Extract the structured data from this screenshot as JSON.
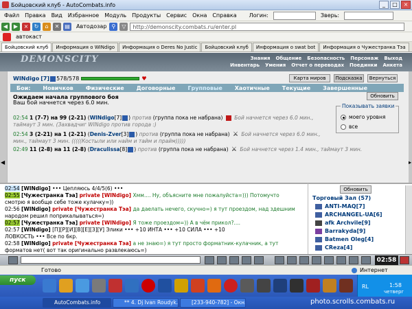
{
  "window": {
    "title": "Бойцовский клуб - AutoCombats.info"
  },
  "menu": {
    "items": [
      "Файл",
      "Правка",
      "Вид",
      "Избранное",
      "Модуль",
      "Продукты",
      "Сервис",
      "Окна",
      "Справка"
    ],
    "login_label": "Логин:",
    "beast_label": "Зверь:"
  },
  "toolbar": {
    "autofill_label": "Автодозар",
    "address": "http://demonscity.combats.ru/enter.pl"
  },
  "links": {
    "autotext": "автокаст"
  },
  "tabs": [
    "Бойцовский клуб",
    "Информация о WINdigo",
    "Информация о Deres No Justic",
    "Бойцовский клуб",
    "Информация о swat bot",
    "Информация о Чужестранка Тэа"
  ],
  "game": {
    "logo": "DEMONSCITY",
    "topnav": [
      "Знания",
      "Общение",
      "Безопасность",
      "Персонаж",
      "Выход"
    ],
    "subnav": [
      "Инвентарь",
      "Умения",
      "Отчет о переводах",
      "Поединки",
      "Анкета"
    ],
    "player": {
      "name": "WINdigo",
      "level": "[7]",
      "hp": "578/578",
      "hp_fraction": 1.0
    },
    "buttons": {
      "map": "Карта миров",
      "hint": "Подсказка",
      "back": "Вернуться",
      "refresh": "Обновить"
    },
    "fight_tabs": [
      "Бои:",
      "Новичков",
      "Физические",
      "Договорные",
      "Групповые",
      "Хаотичные",
      "Текущие",
      "Завершенные"
    ],
    "wait_heading": "Ожидаем начала группового боя",
    "wait_sub": "Ваш бой начнется через 6.0 мин.",
    "show_box": {
      "legend": "Показывать заявки",
      "opt_my_level": "моего уровня",
      "opt_all": "все"
    },
    "fights": [
      {
        "time": "02:54",
        "line1_a": "1 (7-7) на 99 (2-21)",
        "leader": "WINdigo",
        "leader_level": "[7]",
        "line1_b": "против",
        "line1_c": "(группа пока не набрана)",
        "line1_d": "Бой начнется через 6.0 мин.,",
        "line2": "таймаут 3 мин. (Захвадчиг WINdigo против города :)"
      },
      {
        "time": "02:54",
        "line1_a": "3 (2-21) на 1 (2-21)",
        "leader": "Denis-Zver",
        "leader_level": "[3]",
        "line1_b": "против",
        "line1_c": "(группа пока не набрана)",
        "line1_d": "Бой начнется через 6.0 мин.,",
        "line2": "мин., таймаут 3 мин. (((((Костыли или найм и тайм и прайм)))))"
      },
      {
        "time": "02:49",
        "line1_a": "11 (2-8) на 11 (2-8)",
        "leader": "Draculissa",
        "leader_level": "[8]",
        "line1_b": "против",
        "line1_c": "(группа пока не набрана)",
        "line1_d": "Бой начнется через 1.4 мин., таймаут 3 мин.",
        "line2": ""
      }
    ]
  },
  "chat": {
    "lines": [
      {
        "time": "02:54",
        "who": "[WINdigo]",
        "pv": "",
        "text": "••• Цепляюсь 4/4/5(6) •••"
      },
      {
        "time": "02:55",
        "who": "[Чужестранка Тэа]",
        "pv": "private [WINdigo]",
        "text": "Хмм.... Ну, объясните мне пожалуйста=))) Потомучто"
      },
      {
        "time": "",
        "who": "",
        "pv": "",
        "text": "смотрю я вообще себе тоже кулачку=))"
      },
      {
        "time": "02:56",
        "who": "[WINdigo]",
        "pv": "private [Чужестранка Тэа]",
        "text": "да даелать нечего, скучно=) я тут проездом, над здешним"
      },
      {
        "time": "",
        "who": "",
        "pv": "",
        "text": "народом решил поприкалываться=)"
      },
      {
        "time": "02:57",
        "who": "[Чужестранка Тэа]",
        "pv": "private [WINdigo]",
        "text": "Я тоже проездом=)) А в чём прикол?...."
      },
      {
        "time": "02:57",
        "who": "[WINdigo]",
        "pv": "",
        "text": "[П][Р][И][В][Е][З][У] Элики ••• +10 ИНТА ••• +10 СИЛА ••• +10"
      },
      {
        "time": "",
        "who": "",
        "pv": "",
        "text": "ЛОВКОСТЬ ••• Все по 6кр."
      },
      {
        "time": "02:58",
        "who": "[WINdigo]",
        "pv": "private [Чужестранка Тэа]",
        "text": "а не знаю=) я тут просто форматник-кулачник, а тут"
      },
      {
        "time": "",
        "who": "",
        "pv": "",
        "text": "форматов нет( вот так оригинально развлекаюсь=)"
      }
    ],
    "refresh_label": "Обновить",
    "room_title": "Торговый Зал (57)",
    "users": [
      "ANTI-MAQ[7]",
      "ARCHANGEL-UA[6]",
      "afk Archvile[9]",
      "Barrakyda[9]",
      "Batmen Oleg[4]",
      "CReza[4]"
    ],
    "clock": "02:58"
  },
  "status": {
    "done": "Готово",
    "zone": "Интернет"
  },
  "taskbar": {
    "start": "пуск",
    "tasks": [
      "AutoCombats.info",
      "** 4. Dj Ivan Roudyk...",
      "[233-940-782] - Окн..."
    ],
    "lang": "RL",
    "time": "1:58",
    "day": "четверг",
    "watermark": "photo.scrolls.combats.ru"
  }
}
